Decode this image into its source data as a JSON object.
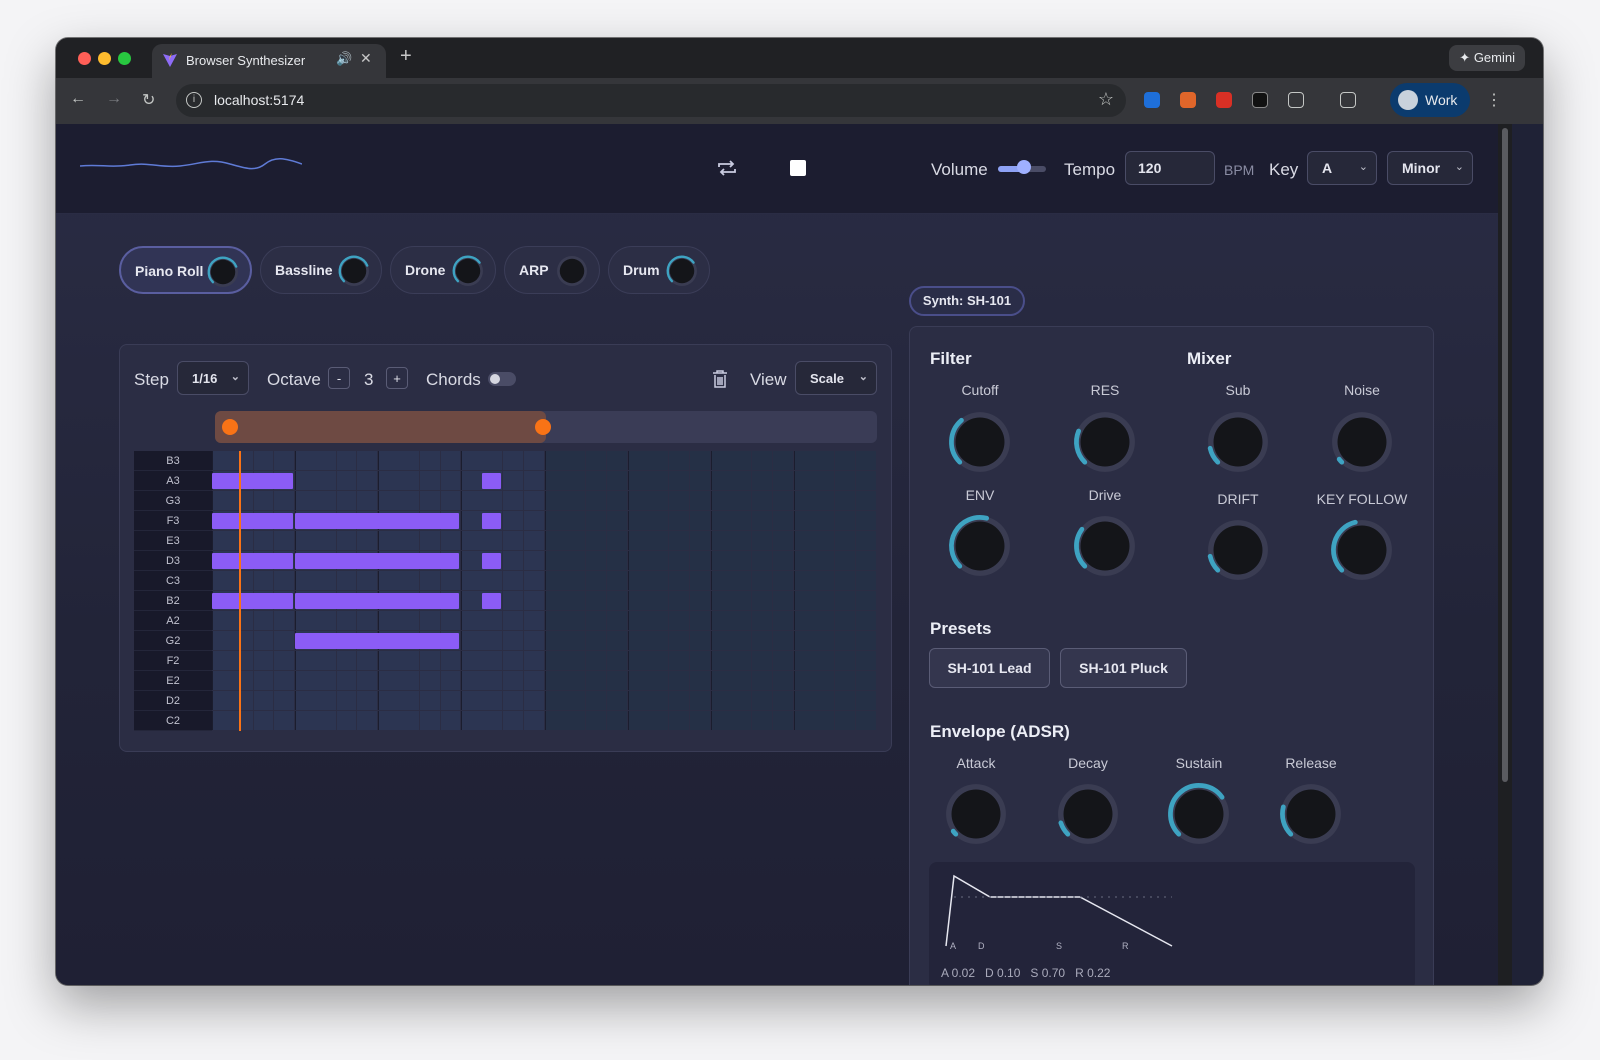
{
  "browser": {
    "tab_title": "Browser Synthesizer",
    "url": "localhost:5174",
    "gemini_label": "Gemini",
    "profile_label": "Work"
  },
  "header": {
    "volume_label": "Volume",
    "volume_level": 0.55,
    "tempo_label": "Tempo",
    "tempo_value": "120",
    "bpm_label": "BPM",
    "key_label": "Key",
    "key_value": "A",
    "scale_value": "Minor"
  },
  "tracks": [
    {
      "label": "Piano Roll",
      "level": 0.75,
      "active": true
    },
    {
      "label": "Bassline",
      "level": 0.75,
      "active": false
    },
    {
      "label": "Drone",
      "level": 0.7,
      "active": false
    },
    {
      "label": "ARP",
      "level": 0.0,
      "active": false
    },
    {
      "label": "Drum",
      "level": 0.7,
      "active": false
    }
  ],
  "piano_roll": {
    "step_label": "Step",
    "step_value": "1/16",
    "octave_label": "Octave",
    "octave_minus": "-",
    "octave_value": "3",
    "octave_plus": "+",
    "chords_label": "Chords",
    "view_label": "View",
    "view_value": "Scale",
    "rows": [
      "B3",
      "A3",
      "G3",
      "F3",
      "E3",
      "D3",
      "C3",
      "B2",
      "A2",
      "G2",
      "F2",
      "E2",
      "D2",
      "C2"
    ],
    "steps": 32,
    "loop_start_step": 0,
    "loop_end_step": 16,
    "playhead_step": 1.3,
    "notes": [
      {
        "note": "A3",
        "start": 0,
        "len": 4
      },
      {
        "note": "A3",
        "start": 13,
        "len": 1
      },
      {
        "note": "F3",
        "start": 0,
        "len": 4
      },
      {
        "note": "F3",
        "start": 4,
        "len": 8
      },
      {
        "note": "F3",
        "start": 13,
        "len": 1
      },
      {
        "note": "D3",
        "start": 0,
        "len": 4
      },
      {
        "note": "D3",
        "start": 4,
        "len": 8
      },
      {
        "note": "D3",
        "start": 13,
        "len": 1
      },
      {
        "note": "B2",
        "start": 0,
        "len": 4
      },
      {
        "note": "B2",
        "start": 4,
        "len": 8
      },
      {
        "note": "B2",
        "start": 13,
        "len": 1
      },
      {
        "note": "G2",
        "start": 4,
        "len": 8
      }
    ]
  },
  "synth": {
    "label": "Synth: SH-101",
    "filter_title": "Filter",
    "mixer_title": "Mixer",
    "knobs": {
      "cutoff": {
        "label": "Cutoff",
        "level": 0.35
      },
      "res": {
        "label": "RES",
        "level": 0.25
      },
      "sub": {
        "label": "Sub",
        "level": 0.12
      },
      "noise": {
        "label": "Noise",
        "level": 0.03
      },
      "env": {
        "label": "ENV",
        "level": 0.55
      },
      "drive": {
        "label": "Drive",
        "level": 0.3
      },
      "drift": {
        "label": "DRIFT",
        "level": 0.12
      },
      "keyfollow": {
        "label": "KEY FOLLOW",
        "level": 0.45
      }
    },
    "presets_title": "Presets",
    "presets": [
      "SH-101 Lead",
      "SH-101 Pluck"
    ],
    "envelope_title": "Envelope (ADSR)",
    "envelope": {
      "attack": {
        "label": "Attack",
        "level": 0.03
      },
      "decay": {
        "label": "Decay",
        "level": 0.1
      },
      "sustain": {
        "label": "Sustain",
        "level": 0.7
      },
      "release": {
        "label": "Release",
        "level": 0.22
      }
    },
    "adsr_graph": {
      "letters": [
        "A",
        "D",
        "S",
        "R"
      ],
      "values": [
        "A 0.02",
        "D 0.10",
        "S 0.70",
        "R 0.22"
      ],
      "a": 0.02,
      "d": 0.1,
      "s": 0.7,
      "r": 0.22
    }
  },
  "colors": {
    "accent": "#3ea3c2",
    "note": "#8b5cf6",
    "loop": "#f97316"
  }
}
